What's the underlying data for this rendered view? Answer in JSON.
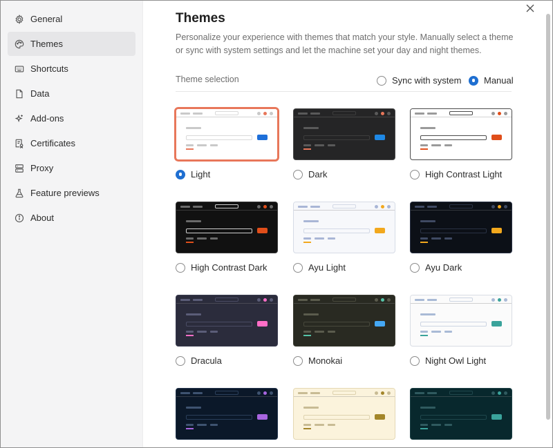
{
  "sidebar": {
    "items": [
      {
        "label": "General",
        "icon": "gear-icon"
      },
      {
        "label": "Themes",
        "icon": "palette-icon",
        "active": true
      },
      {
        "label": "Shortcuts",
        "icon": "keyboard-icon"
      },
      {
        "label": "Data",
        "icon": "file-icon"
      },
      {
        "label": "Add-ons",
        "icon": "sparkle-icon"
      },
      {
        "label": "Certificates",
        "icon": "certificate-icon"
      },
      {
        "label": "Proxy",
        "icon": "proxy-icon"
      },
      {
        "label": "Feature previews",
        "icon": "flask-icon"
      },
      {
        "label": "About",
        "icon": "info-icon"
      }
    ]
  },
  "main": {
    "title": "Themes",
    "description": "Personalize your experience with themes that match your style. Manually select a theme or sync with system settings and let the machine set your day and night themes.",
    "selection_label": "Theme selection",
    "sync_label": "Sync with system",
    "manual_label": "Manual",
    "mode": "manual"
  },
  "themes": [
    {
      "name": "Light",
      "selected": true,
      "bg": "#ffffff",
      "bar": "#ffffff",
      "dash": "#c9c9c9",
      "input": "#d9d9d9",
      "btn": "#1e6fd9",
      "accent": "#e8775a",
      "border": "#d6d6d6"
    },
    {
      "name": "Dark",
      "selected": false,
      "bg": "#252526",
      "bar": "#252526",
      "dash": "#5a5a5a",
      "input": "#3d3d3d",
      "btn": "#1e88e5",
      "accent": "#e8775a",
      "border": "#4a4a4a"
    },
    {
      "name": "High Contrast Light",
      "selected": false,
      "bg": "#ffffff",
      "bar": "#ffffff",
      "dash": "#9a9a9a",
      "input": "#4a4a4a",
      "btn": "#e04e1a",
      "accent": "#e04e1a",
      "border": "#4a4a4a"
    },
    {
      "name": "High Contrast Dark",
      "selected": false,
      "bg": "#111111",
      "bar": "#111111",
      "dash": "#6a6a6a",
      "input": "#cfcfcf",
      "btn": "#e04e1a",
      "accent": "#e04e1a",
      "border": "#3a3a3a"
    },
    {
      "name": "Ayu Light",
      "selected": false,
      "bg": "#f7f8fb",
      "bar": "#f7f8fb",
      "dash": "#a9b6d6",
      "input": "#d3d9e6",
      "btn": "#f2a81d",
      "accent": "#f2a81d",
      "border": "#d6dbe6"
    },
    {
      "name": "Ayu Dark",
      "selected": false,
      "bg": "#0c1017",
      "bar": "#0c1017",
      "dash": "#3f4a63",
      "input": "#2a3244",
      "btn": "#f2a81d",
      "accent": "#f2a81d",
      "border": "#2a3244"
    },
    {
      "name": "Dracula",
      "selected": false,
      "bg": "#2b2c3c",
      "bar": "#2b2c3c",
      "dash": "#5b5d78",
      "input": "#4a4c64",
      "btn": "#ff6ec7",
      "accent": "#ff6ec7",
      "border": "#3a3c50"
    },
    {
      "name": "Monokai",
      "selected": false,
      "bg": "#292a22",
      "bar": "#292a22",
      "dash": "#5b5c4d",
      "input": "#48493c",
      "btn": "#45a8f5",
      "accent": "#55c4a8",
      "border": "#3b3c32"
    },
    {
      "name": "Night Owl Light",
      "selected": false,
      "bg": "#fbfbfb",
      "bar": "#fbfbfb",
      "dash": "#a9bad6",
      "input": "#cdd5e2",
      "btn": "#3aa39b",
      "accent": "#3aa39b",
      "border": "#d9dde4"
    },
    {
      "name": "",
      "selected": false,
      "bg": "#0b1829",
      "bar": "#0b1829",
      "dash": "#3e5370",
      "input": "#2a3e5a",
      "btn": "#a865e0",
      "accent": "#a865e0",
      "border": "#22344c"
    },
    {
      "name": "",
      "selected": false,
      "bg": "#fbf3dc",
      "bar": "#fbf3dc",
      "dash": "#c8bb94",
      "input": "#ded2ae",
      "btn": "#a3862a",
      "accent": "#a3862a",
      "border": "#e4d8b4"
    },
    {
      "name": "",
      "selected": false,
      "bg": "#08282d",
      "bar": "#08282d",
      "dash": "#2f5a5f",
      "input": "#1f474c",
      "btn": "#3aa39b",
      "accent": "#3aa39b",
      "border": "#1c4045"
    }
  ]
}
